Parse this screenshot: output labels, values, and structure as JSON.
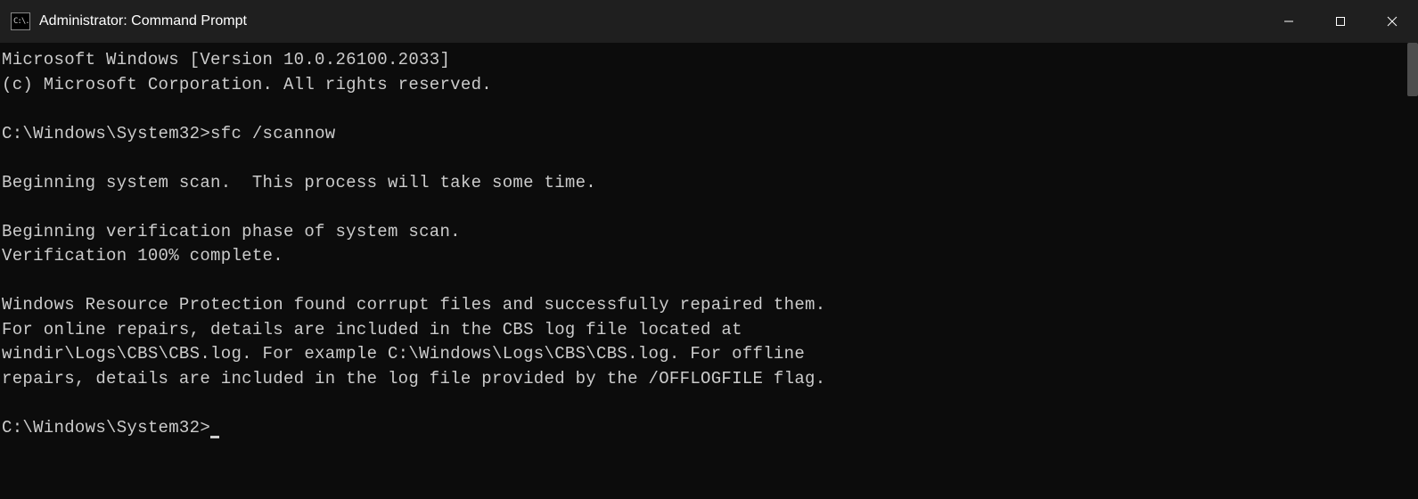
{
  "window": {
    "title": "Administrator: Command Prompt",
    "icon_text": "C:\\."
  },
  "terminal": {
    "header_line1": "Microsoft Windows [Version 10.0.26100.2033]",
    "header_line2": "(c) Microsoft Corporation. All rights reserved.",
    "prompt1_path": "C:\\Windows\\System32>",
    "prompt1_command": "sfc /scannow",
    "output_line1": "Beginning system scan.  This process will take some time.",
    "output_line2": "Beginning verification phase of system scan.",
    "output_line3": "Verification 100% complete.",
    "output_line4": "Windows Resource Protection found corrupt files and successfully repaired them.",
    "output_line5": "For online repairs, details are included in the CBS log file located at",
    "output_line6": "windir\\Logs\\CBS\\CBS.log. For example C:\\Windows\\Logs\\CBS\\CBS.log. For offline",
    "output_line7": "repairs, details are included in the log file provided by the /OFFLOGFILE flag.",
    "prompt2_path": "C:\\Windows\\System32>"
  }
}
